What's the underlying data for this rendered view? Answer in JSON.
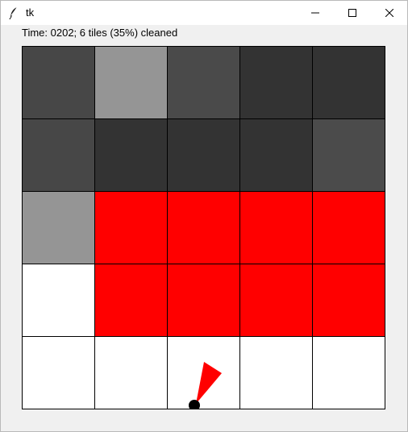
{
  "window": {
    "title": "tk",
    "icon": "feather-icon",
    "controls": [
      "minimize-icon",
      "maximize-icon",
      "close-icon"
    ]
  },
  "status": {
    "text": "Time: 0202; 6 tiles (35%) cleaned"
  },
  "grid": {
    "rows": 5,
    "cols": 5,
    "tiles": [
      [
        "#474747",
        "#959595",
        "#4a4a4a",
        "#333333",
        "#333333"
      ],
      [
        "#474747",
        "#333333",
        "#333333",
        "#333333",
        "#4b4b4b"
      ],
      [
        "#959595",
        "#ff0000",
        "#ff0000",
        "#ff0000",
        "#ff0000"
      ],
      [
        "#ffffff",
        "#ff0000",
        "#ff0000",
        "#ff0000",
        "#ff0000"
      ],
      [
        "#ffffff",
        "#ffffff",
        "#ffffff",
        "#ffffff",
        "#ffffff"
      ]
    ]
  },
  "robot": {
    "body_color": "#000000",
    "pointer_color": "#ff0000"
  }
}
